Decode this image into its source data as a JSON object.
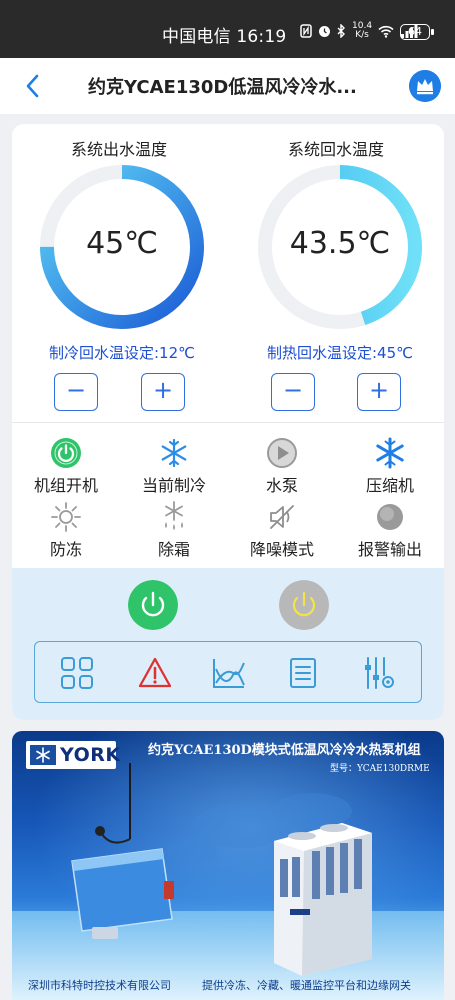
{
  "status_bar": {
    "carrier_time": "中国电信 16:19",
    "speed": "10.4",
    "speed_unit": "K/s",
    "battery": "64"
  },
  "header": {
    "title": "约克YCAE130D低温风冷冷水..."
  },
  "gauges": [
    {
      "title": "系统出水温度",
      "value": "45℃",
      "fill_fraction": 0.75,
      "setpoint": "制冷回水温设定:12℃"
    },
    {
      "title": "系统回水温度",
      "value": "43.5℃",
      "fill_fraction": 0.45,
      "setpoint": "制热回水温设定:45℃"
    }
  ],
  "stepper": {
    "minus": "−",
    "plus": "+"
  },
  "status_items": [
    {
      "label": "机组开机",
      "icon": "power-on-icon"
    },
    {
      "label": "当前制冷",
      "icon": "snowflake-icon"
    },
    {
      "label": "水泵",
      "icon": "pump-icon"
    },
    {
      "label": "压缩机",
      "icon": "compressor-snowflake-icon"
    },
    {
      "label": "防冻",
      "icon": "antifreeze-sun-icon"
    },
    {
      "label": "除霜",
      "icon": "defrost-icon"
    },
    {
      "label": "降噪模式",
      "icon": "mute-icon"
    },
    {
      "label": "报警输出",
      "icon": "alarm-dot-icon"
    }
  ],
  "controls": {
    "power_on_color": "#2fc36a",
    "power_off_color": "#b8b8b8"
  },
  "toolbar": [
    "grid-icon",
    "alert-icon",
    "curve-icon",
    "list-icon",
    "settings-sliders-icon"
  ],
  "banner": {
    "logo": "YORK",
    "title": "约克YCAE130D模块式低温风冷冷水热泵机组",
    "model": "型号：YCAE130DRME",
    "footer_left": "深圳市科特时控技术有限公司",
    "footer_right": "提供冷冻、冷藏、暖通监控平台和边缘网关"
  },
  "colors": {
    "accent": "#1e7ee6",
    "setpoint_text": "#1c4fd1",
    "gauge_start": "#1a5ad6",
    "gauge_end": "#5fd6f5",
    "panel_bg": "#ddeefa"
  }
}
